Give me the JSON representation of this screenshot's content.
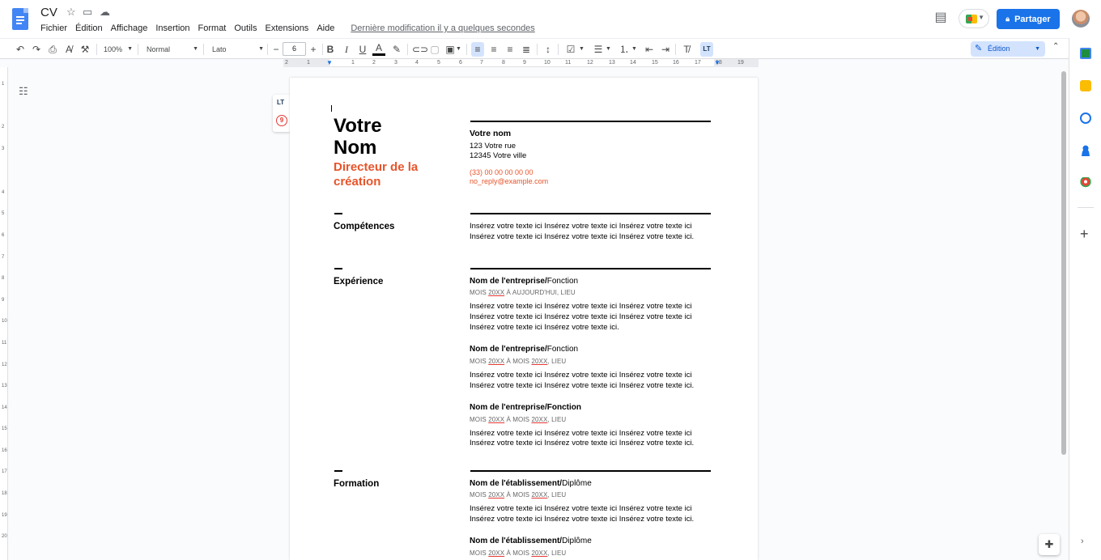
{
  "header": {
    "title": "CV",
    "menu": [
      "Fichier",
      "Édition",
      "Affichage",
      "Insertion",
      "Format",
      "Outils",
      "Extensions",
      "Aide"
    ],
    "last_edit": "Dernière modification il y a quelques secondes",
    "share_label": "Partager"
  },
  "toolbar": {
    "zoom": "100%",
    "style": "Normal",
    "font": "Lato",
    "font_size": "6",
    "minus": "−",
    "plus": "+",
    "mode": "Édition"
  },
  "ruler": {
    "h_numbers": [
      "2",
      "1",
      "1",
      "2",
      "3",
      "4",
      "5",
      "6",
      "7",
      "8",
      "9",
      "10",
      "11",
      "12",
      "13",
      "14",
      "15",
      "16",
      "17",
      "18",
      "19"
    ],
    "v_numbers": [
      "1",
      "2",
      "3",
      "4",
      "5",
      "6",
      "7",
      "8",
      "9",
      "10",
      "11",
      "12",
      "13",
      "14",
      "15",
      "16",
      "17",
      "18",
      "19",
      "20"
    ]
  },
  "grammar_widget": {
    "logo": "LT",
    "count": "9"
  },
  "document": {
    "name_line1": "Votre",
    "name_line2": "Nom",
    "role_line1": "Directeur de la",
    "role_line2": "création",
    "contact": {
      "name": "Votre nom",
      "street": "123 Votre rue",
      "city": "12345 Votre ville",
      "phone": "(33) 00 00 00 00 00",
      "email": "no_reply@example.com"
    },
    "sections": {
      "skills": "Compétences",
      "experience": "Expérience",
      "education": "Formation"
    },
    "lorem_a": "Insérez votre texte ici Insérez votre texte ici Insérez votre texte ici",
    "lorem_b": "Insérez votre texte ici Insérez votre texte ici Insérez votre texte ici.",
    "lorem_c": "Insérez votre texte ici Insérez votre texte ici.",
    "company": "Nom de l'entreprise/",
    "company_full": "Nom de l'entreprise/Fonction",
    "position": "Fonction",
    "school": "Nom de l'établissement/",
    "diploma": "Diplôme",
    "meta_mois": "MOIS",
    "meta_year": "20XX",
    "meta_to": "À",
    "meta_today": "AUJOURD'HUI, LIEU",
    "meta_lieu": ", LIEU"
  },
  "colors": {
    "accent": "#e8542a",
    "brand": "#1a73e8"
  }
}
